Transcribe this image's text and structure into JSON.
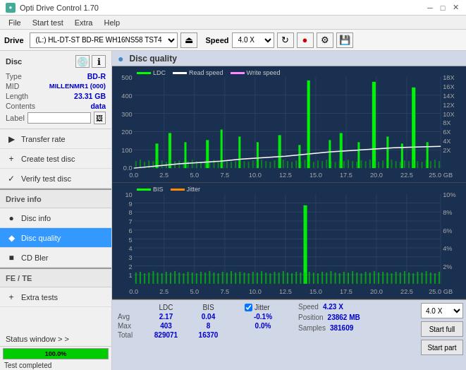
{
  "app": {
    "title": "Opti Drive Control 1.70",
    "icon": "●"
  },
  "titlebar": {
    "minimize": "─",
    "maximize": "□",
    "close": "✕"
  },
  "menubar": {
    "items": [
      "File",
      "Start test",
      "Extra",
      "Help"
    ]
  },
  "toolbar": {
    "drive_label": "Drive",
    "drive_value": "(L:)  HL-DT-ST BD-RE  WH16NS58 TST4",
    "speed_label": "Speed",
    "speed_value": "4.0 X"
  },
  "disc": {
    "type_label": "Type",
    "type_value": "BD-R",
    "mid_label": "MID",
    "mid_value": "MILLENMR1 (000)",
    "length_label": "Length",
    "length_value": "23.31 GB",
    "contents_label": "Contents",
    "contents_value": "data",
    "label_label": "Label",
    "label_placeholder": ""
  },
  "nav": {
    "items": [
      {
        "id": "transfer-rate",
        "label": "Transfer rate",
        "icon": "▶"
      },
      {
        "id": "create-test-disc",
        "label": "Create test disc",
        "icon": "+"
      },
      {
        "id": "verify-test-disc",
        "label": "Verify test disc",
        "icon": "✓"
      },
      {
        "id": "drive-info",
        "label": "Drive info",
        "icon": "i"
      },
      {
        "id": "disc-info",
        "label": "Disc info",
        "icon": "●"
      },
      {
        "id": "disc-quality",
        "label": "Disc quality",
        "icon": "◆",
        "active": true
      },
      {
        "id": "cd-bler",
        "label": "CD Bler",
        "icon": "■"
      },
      {
        "id": "fe-te",
        "label": "FE / TE",
        "icon": "~"
      },
      {
        "id": "extra-tests",
        "label": "Extra tests",
        "icon": "+"
      }
    ]
  },
  "status_window": {
    "label": "Status window > >"
  },
  "progress": {
    "value": 100,
    "text": "100.0%"
  },
  "status_text": "Test completed",
  "disc_quality": {
    "title": "Disc quality",
    "legend": {
      "ldc": "LDC",
      "read_speed": "Read speed",
      "write_speed": "Write speed",
      "bis": "BIS",
      "jitter": "Jitter"
    }
  },
  "chart1": {
    "y_labels_left": [
      "500",
      "400",
      "300",
      "200",
      "100",
      "0.0"
    ],
    "y_labels_right": [
      "18X",
      "16X",
      "14X",
      "12X",
      "10X",
      "8X",
      "6X",
      "4X",
      "2X"
    ],
    "x_labels": [
      "0.0",
      "2.5",
      "5.0",
      "7.5",
      "10.0",
      "12.5",
      "15.0",
      "17.5",
      "20.0",
      "22.5",
      "25.0 GB"
    ]
  },
  "chart2": {
    "y_labels_left": [
      "10",
      "9",
      "8",
      "7",
      "6",
      "5",
      "4",
      "3",
      "2",
      "1"
    ],
    "y_labels_right": [
      "10%",
      "8%",
      "6%",
      "4%",
      "2%"
    ],
    "x_labels": [
      "0.0",
      "2.5",
      "5.0",
      "7.5",
      "10.0",
      "12.5",
      "15.0",
      "17.5",
      "20.0",
      "22.5",
      "25.0 GB"
    ]
  },
  "stats": {
    "columns": [
      "LDC",
      "BIS",
      "",
      "Jitter",
      "Speed",
      "4.23 X",
      "",
      "4.0 X"
    ],
    "avg_label": "Avg",
    "avg_ldc": "2.17",
    "avg_bis": "0.04",
    "avg_jitter": "-0.1%",
    "max_label": "Max",
    "max_ldc": "403",
    "max_bis": "8",
    "max_jitter": "0.0%",
    "total_label": "Total",
    "total_ldc": "829071",
    "total_bis": "16370",
    "position_label": "Position",
    "position_value": "23862 MB",
    "samples_label": "Samples",
    "samples_value": "381609",
    "jitter_checked": true,
    "speed_label": "Speed",
    "speed_value": "4.23 X",
    "start_full": "Start full",
    "start_part": "Start part"
  }
}
